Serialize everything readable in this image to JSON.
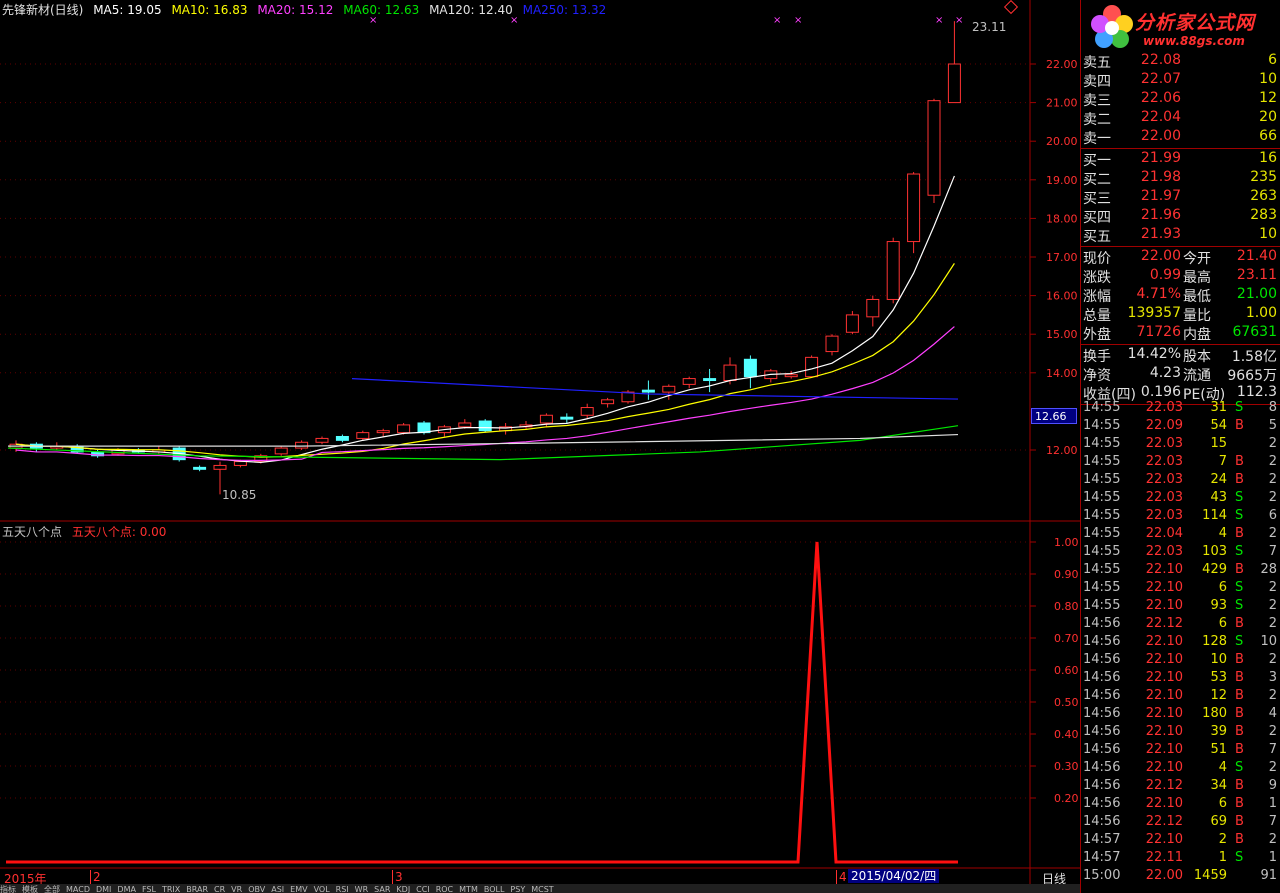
{
  "chart": {
    "title": "先锋新材(日线)",
    "ma": [
      {
        "label": "MA5: 19.05",
        "color": "#ffffff"
      },
      {
        "label": "MA10: 16.83",
        "color": "#ffff00"
      },
      {
        "label": "MA20: 15.12",
        "color": "#ff40ff"
      },
      {
        "label": "MA60: 12.63",
        "color": "#00e600"
      },
      {
        "label": "MA120: 12.40",
        "color": "#e0e0e0"
      },
      {
        "label": "MA250: 13.32",
        "color": "#2020ff"
      }
    ],
    "price_axis": [
      "22.00",
      "21.00",
      "20.00",
      "19.00",
      "18.00",
      "17.00",
      "16.00",
      "15.00",
      "14.00",
      "12.00"
    ],
    "current_price_marker": "12.66",
    "high_label": "23.11",
    "low_label": "10.85",
    "indicator_name": "五天八个点",
    "indicator_value": "五天八个点: 0.00",
    "indicator_axis": [
      "1.00",
      "0.90",
      "0.80",
      "0.70",
      "0.60",
      "0.50",
      "0.40",
      "0.30",
      "0.20"
    ],
    "x_labels": [
      "2015年",
      "2",
      "3",
      "4"
    ],
    "date_label": "2015/04/02/四",
    "period_label": "日线"
  },
  "quotes": {
    "sell": [
      {
        "name": "卖五",
        "price": "22.08",
        "vol": "6"
      },
      {
        "name": "卖四",
        "price": "22.07",
        "vol": "10"
      },
      {
        "name": "卖三",
        "price": "22.06",
        "vol": "12"
      },
      {
        "name": "卖二",
        "price": "22.04",
        "vol": "20"
      },
      {
        "name": "卖一",
        "price": "22.00",
        "vol": "66"
      }
    ],
    "buy": [
      {
        "name": "买一",
        "price": "21.99",
        "vol": "16"
      },
      {
        "name": "买二",
        "price": "21.98",
        "vol": "235"
      },
      {
        "name": "买三",
        "price": "21.97",
        "vol": "263"
      },
      {
        "name": "买四",
        "price": "21.96",
        "vol": "283"
      },
      {
        "name": "买五",
        "price": "21.93",
        "vol": "10"
      }
    ],
    "stats1": [
      {
        "k1": "现价",
        "v1": "22.00",
        "k2": "今开",
        "v2": "21.40",
        "c1": "red",
        "c2": "red"
      },
      {
        "k1": "涨跌",
        "v1": "0.99",
        "k2": "最高",
        "v2": "23.11",
        "c1": "red",
        "c2": "red"
      },
      {
        "k1": "涨幅",
        "v1": "4.71%",
        "k2": "最低",
        "v2": "21.00",
        "c1": "red",
        "c2": "green"
      },
      {
        "k1": "总量",
        "v1": "139357",
        "k2": "量比",
        "v2": "1.00",
        "c1": "yellow",
        "c2": "yellow"
      },
      {
        "k1": "外盘",
        "v1": "71726",
        "k2": "内盘",
        "v2": "67631",
        "c1": "red",
        "c2": "green"
      }
    ],
    "stats2": [
      {
        "k1": "换手",
        "v1": "14.42%",
        "k2": "股本",
        "v2": "1.58亿"
      },
      {
        "k1": "净资",
        "v1": "4.23",
        "k2": "流通",
        "v2": "9665万"
      },
      {
        "k1": "收益(四)",
        "v1": "0.196",
        "k2": "PE(动)",
        "v2": "112.3"
      }
    ]
  },
  "ticks": [
    {
      "t": "14:55",
      "p": "22.03",
      "v": "31",
      "d": "S",
      "n": "8"
    },
    {
      "t": "14:55",
      "p": "22.09",
      "v": "54",
      "d": "B",
      "n": "5"
    },
    {
      "t": "14:55",
      "p": "22.03",
      "v": "15",
      "d": "",
      "n": "2"
    },
    {
      "t": "14:55",
      "p": "22.03",
      "v": "7",
      "d": "B",
      "n": "2"
    },
    {
      "t": "14:55",
      "p": "22.03",
      "v": "24",
      "d": "B",
      "n": "2"
    },
    {
      "t": "14:55",
      "p": "22.03",
      "v": "43",
      "d": "S",
      "n": "2"
    },
    {
      "t": "14:55",
      "p": "22.03",
      "v": "114",
      "d": "S",
      "n": "6"
    },
    {
      "t": "14:55",
      "p": "22.04",
      "v": "4",
      "d": "B",
      "n": "2"
    },
    {
      "t": "14:55",
      "p": "22.03",
      "v": "103",
      "d": "S",
      "n": "7"
    },
    {
      "t": "14:55",
      "p": "22.10",
      "v": "429",
      "d": "B",
      "n": "28"
    },
    {
      "t": "14:55",
      "p": "22.10",
      "v": "6",
      "d": "S",
      "n": "2"
    },
    {
      "t": "14:55",
      "p": "22.10",
      "v": "93",
      "d": "S",
      "n": "2"
    },
    {
      "t": "14:56",
      "p": "22.12",
      "v": "6",
      "d": "B",
      "n": "2"
    },
    {
      "t": "14:56",
      "p": "22.10",
      "v": "128",
      "d": "S",
      "n": "10"
    },
    {
      "t": "14:56",
      "p": "22.10",
      "v": "10",
      "d": "B",
      "n": "2"
    },
    {
      "t": "14:56",
      "p": "22.10",
      "v": "53",
      "d": "B",
      "n": "3"
    },
    {
      "t": "14:56",
      "p": "22.10",
      "v": "12",
      "d": "B",
      "n": "2"
    },
    {
      "t": "14:56",
      "p": "22.10",
      "v": "180",
      "d": "B",
      "n": "4"
    },
    {
      "t": "14:56",
      "p": "22.10",
      "v": "39",
      "d": "B",
      "n": "2"
    },
    {
      "t": "14:56",
      "p": "22.10",
      "v": "51",
      "d": "B",
      "n": "7"
    },
    {
      "t": "14:56",
      "p": "22.10",
      "v": "4",
      "d": "S",
      "n": "2"
    },
    {
      "t": "14:56",
      "p": "22.12",
      "v": "34",
      "d": "B",
      "n": "9"
    },
    {
      "t": "14:56",
      "p": "22.10",
      "v": "6",
      "d": "B",
      "n": "1"
    },
    {
      "t": "14:56",
      "p": "22.12",
      "v": "69",
      "d": "B",
      "n": "7"
    },
    {
      "t": "14:57",
      "p": "22.10",
      "v": "2",
      "d": "B",
      "n": "2"
    },
    {
      "t": "14:57",
      "p": "22.11",
      "v": "1",
      "d": "S",
      "n": "1"
    },
    {
      "t": "15:00",
      "p": "22.00",
      "v": "1459",
      "d": "",
      "n": "91"
    }
  ],
  "logo": {
    "title": "分析家公式网",
    "url": "www.88gs.com"
  },
  "bottom_tabs": [
    "指标",
    "模板",
    "全部",
    "MACD",
    "DMI",
    "DMA",
    "FSL",
    "TRIX",
    "BRAR",
    "CR",
    "VR",
    "OBV",
    "ASI",
    "EMV",
    "VOL",
    "RSI",
    "WR",
    "SAR",
    "KDJ",
    "CCI",
    "ROC",
    "MTM",
    "BOLL",
    "PSY",
    "MCST"
  ]
}
